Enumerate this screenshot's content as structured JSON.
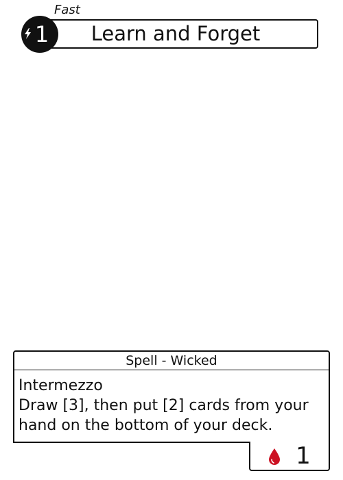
{
  "card": {
    "speed": "Fast",
    "cost": "1",
    "cost_icon": "lightning-bolt-icon",
    "title": "Learn and Forget",
    "type_line": "Spell - Wicked",
    "rules": {
      "keyword": "Intermezzo",
      "line1": "Draw [3], then put [2] cards from your",
      "line2": "hand on the bottom of your deck."
    },
    "blood_icon": "blood-drop-icon",
    "blood_value": "1",
    "colors": {
      "ink": "#111111",
      "blood": "#cc1122",
      "background": "#ffffff"
    }
  }
}
